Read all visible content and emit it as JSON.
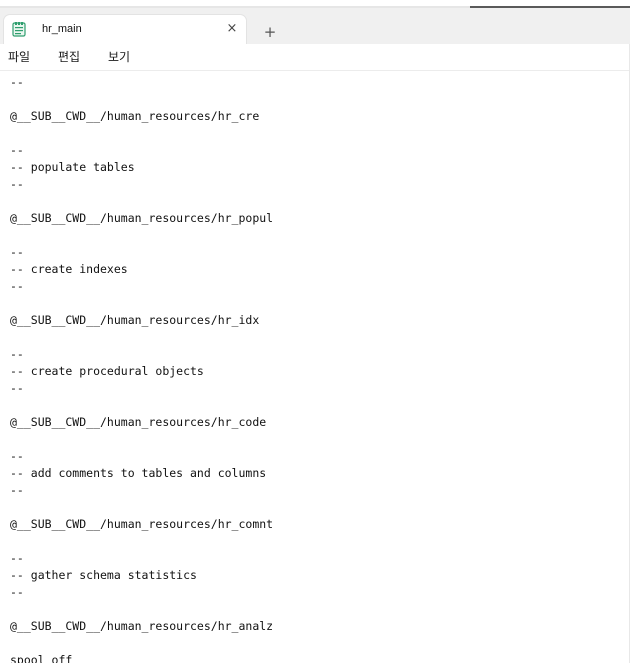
{
  "tab": {
    "title": "hr_main",
    "close_glyph": "×",
    "icon": "notepad-icon"
  },
  "new_tab_glyph": "+",
  "menu": {
    "items": [
      "파일",
      "편집",
      "보기"
    ]
  },
  "editor": {
    "lines": [
      "--",
      "",
      "@__SUB__CWD__/human_resources/hr_cre",
      "",
      "--",
      "-- populate tables",
      "--",
      "",
      "@__SUB__CWD__/human_resources/hr_popul",
      "",
      "--",
      "-- create indexes",
      "--",
      "",
      "@__SUB__CWD__/human_resources/hr_idx",
      "",
      "--",
      "-- create procedural objects",
      "--",
      "",
      "@__SUB__CWD__/human_resources/hr_code",
      "",
      "--",
      "-- add comments to tables and columns",
      "--",
      "",
      "@__SUB__CWD__/human_resources/hr_comnt",
      "",
      "--",
      "-- gather schema statistics",
      "--",
      "",
      "@__SUB__CWD__/human_resources/hr_analz",
      "",
      "spool off"
    ]
  },
  "colors": {
    "tabbar_bg": "#f0f0f0",
    "icon_accent": "#2f9e6e",
    "text": "#111111"
  }
}
